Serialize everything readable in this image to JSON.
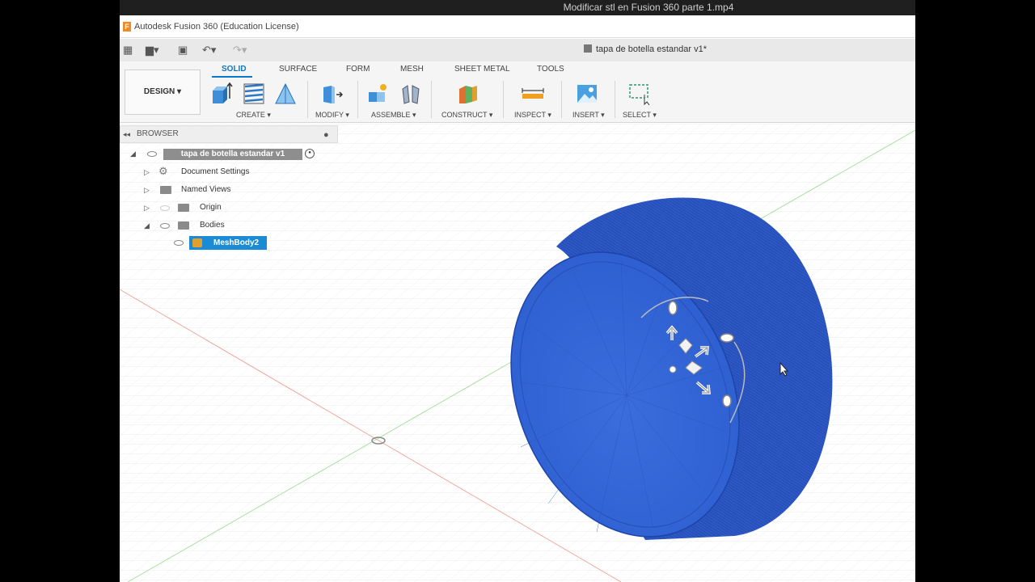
{
  "video": {
    "title": "Modificar stl en Fusion 360 parte 1.mp4"
  },
  "app": {
    "title": "Autodesk Fusion 360 (Education License)",
    "logo": "F"
  },
  "document": {
    "title": "tapa de botella estandar v1*"
  },
  "workspace": {
    "label": "DESIGN ▾"
  },
  "tabs": [
    {
      "label": "SOLID",
      "active": true
    },
    {
      "label": "SURFACE"
    },
    {
      "label": "FORM"
    },
    {
      "label": "MESH"
    },
    {
      "label": "SHEET METAL"
    },
    {
      "label": "TOOLS"
    }
  ],
  "groups": [
    {
      "label": "CREATE ▾"
    },
    {
      "label": "MODIFY ▾"
    },
    {
      "label": "ASSEMBLE ▾"
    },
    {
      "label": "CONSTRUCT ▾"
    },
    {
      "label": "INSPECT ▾"
    },
    {
      "label": "INSERT ▾"
    },
    {
      "label": "SELECT ▾"
    }
  ],
  "browser": {
    "header": "BROWSER",
    "root": "tapa de botella estandar v1",
    "items": [
      {
        "label": "Document Settings"
      },
      {
        "label": "Named Views"
      },
      {
        "label": "Origin"
      },
      {
        "label": "Bodies"
      }
    ],
    "selected_body": "MeshBody2"
  },
  "colors": {
    "accent": "#0a78c8",
    "body": "#2f5fd0",
    "selection": "#1b8bd6"
  }
}
